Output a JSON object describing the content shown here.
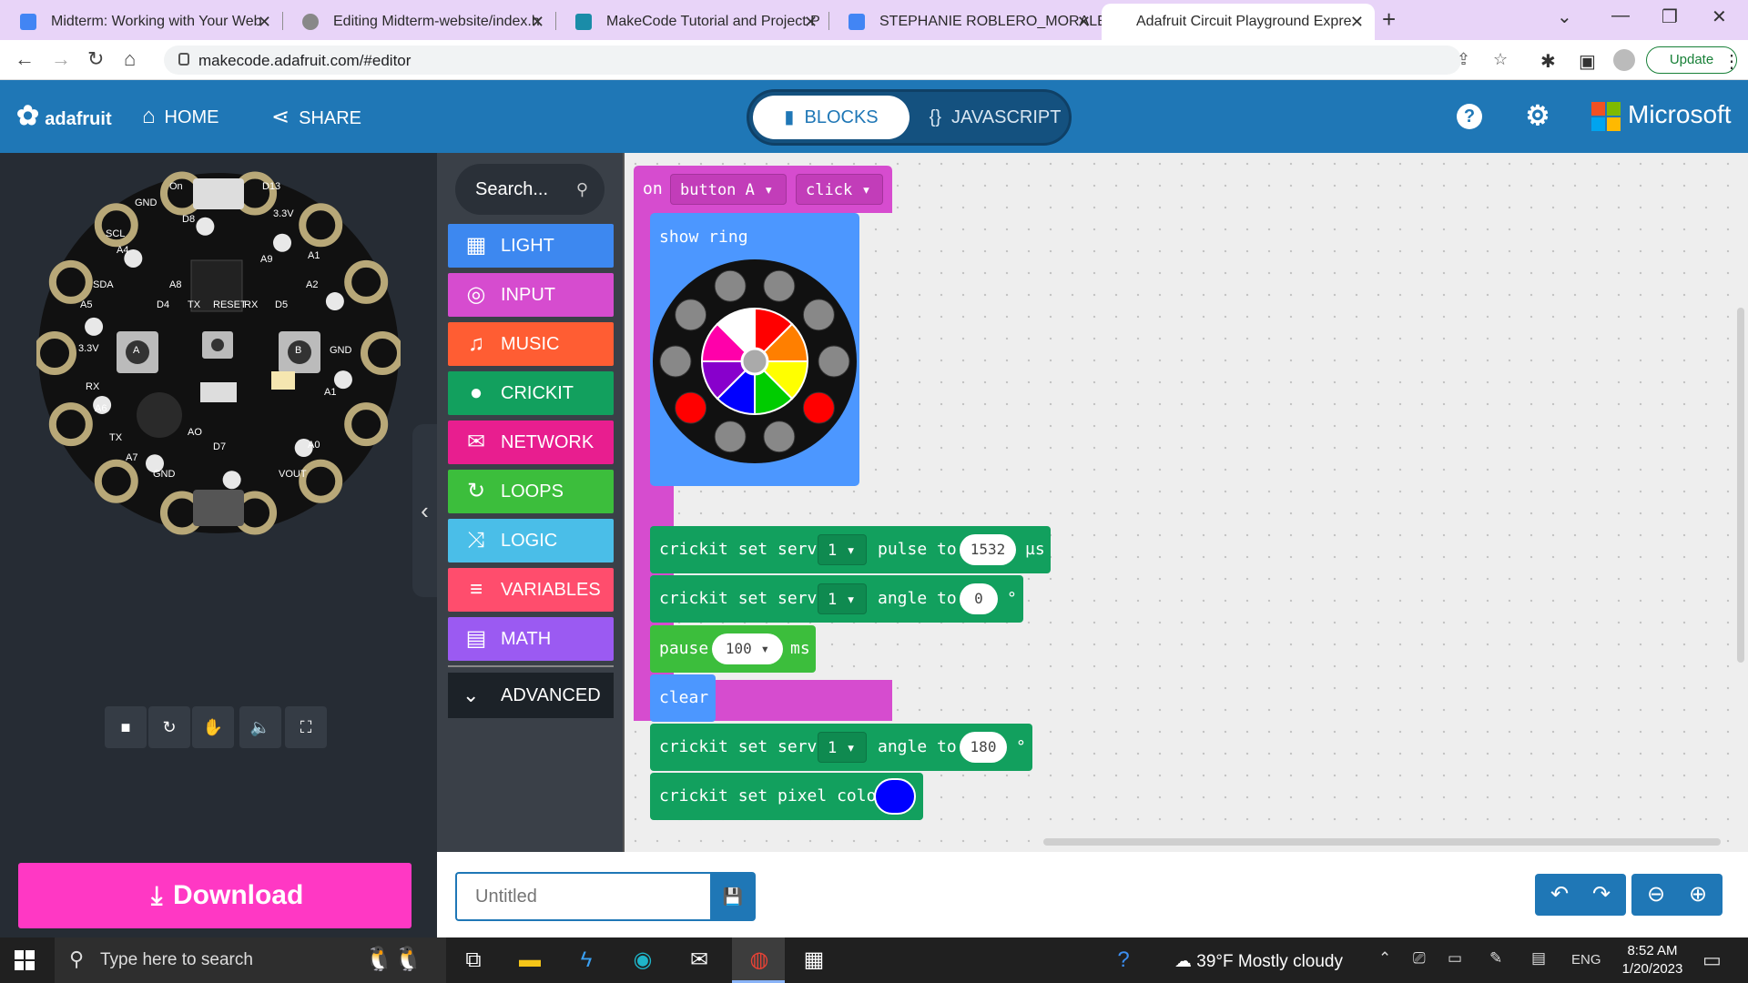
{
  "browser": {
    "tabs": [
      {
        "title": "Midterm: Working with Your Web",
        "color": "#4285f4"
      },
      {
        "title": "Editing Midterm-website/index.h",
        "color": "#888888"
      },
      {
        "title": "MakeCode Tutorial and Project P",
        "color": "#1a8ca8"
      },
      {
        "title": "STEPHANIE ROBLERO_MORALES",
        "color": "#4285f4"
      },
      {
        "title": "Adafruit Circuit Playground Expre",
        "color": ""
      }
    ],
    "url": "makecode.adafruit.com/#editor",
    "update_label": "Update"
  },
  "header": {
    "logo_text": "adafruit",
    "home_label": "HOME",
    "share_label": "SHARE",
    "blocks_label": "BLOCKS",
    "javascript_label": "JAVASCRIPT",
    "help_icon": "?",
    "brand": "Microsoft"
  },
  "simulator": {
    "pin_labels": [
      "On",
      "D13",
      "GND",
      "D8",
      "3.3V",
      "SCL",
      "A4",
      "A1",
      "A9",
      "A8",
      "SDA",
      "A5",
      "A2",
      "D4",
      "TX",
      "RESET",
      "RX",
      "D5",
      "3.3V",
      "GND",
      "RX",
      "A6",
      "A1",
      "TX",
      "A7",
      "AO",
      "D7",
      "A0",
      "GND",
      "VOUT",
      "A",
      "B"
    ],
    "led_colors": [
      "#ff0000",
      "#ff0000"
    ]
  },
  "toolbox": {
    "search_placeholder": "Search...",
    "categories": [
      {
        "label": "LIGHT",
        "color": "#3d88f0",
        "icon": "grid-icon"
      },
      {
        "label": "INPUT",
        "color": "#d64ccf",
        "icon": "target-icon"
      },
      {
        "label": "MUSIC",
        "color": "#ff5d33",
        "icon": "headphones-icon"
      },
      {
        "label": "CRICKIT",
        "color": "#12a05e",
        "icon": "circle-icon"
      },
      {
        "label": "NETWORK",
        "color": "#e81e8f",
        "icon": "chat-icon"
      },
      {
        "label": "LOOPS",
        "color": "#3cbe3c",
        "icon": "refresh-icon"
      },
      {
        "label": "LOGIC",
        "color": "#4abee8",
        "icon": "shuffle-icon"
      },
      {
        "label": "VARIABLES",
        "color": "#ff4d6d",
        "icon": "lines-icon"
      },
      {
        "label": "MATH",
        "color": "#9b5af2",
        "icon": "calculator-icon"
      }
    ],
    "advanced_label": "ADVANCED"
  },
  "blocks": {
    "event": {
      "on": "on",
      "button": "button A",
      "action": "click",
      "color": "#d64ccf"
    },
    "show_ring": {
      "label": "show ring",
      "color": "#4c97ff"
    },
    "ring_colors": [
      "#ff0000",
      "#ff7f00",
      "#ffff00",
      "#00cc00",
      "#0000ff",
      "#8800cc",
      "#ff00aa",
      "#ffffff"
    ],
    "ring_outer_on": [
      "#ff0000",
      "#ff0000"
    ],
    "servo_pulse": {
      "text": "crickit set servo",
      "servo": "1",
      "mid": "pulse to",
      "value": "1532",
      "unit": "µs"
    },
    "servo_angle1": {
      "text": "crickit set servo",
      "servo": "1",
      "mid": "angle to",
      "value": "0",
      "unit": "°"
    },
    "pause": {
      "text": "pause",
      "value": "100",
      "unit": "ms"
    },
    "clear": {
      "text": "clear"
    },
    "servo_angle2": {
      "text": "crickit set servo",
      "servo": "1",
      "mid": "angle to",
      "value": "180",
      "unit": "°"
    },
    "pixel_color": {
      "text": "crickit set pixel color",
      "value_color": "#0000ff"
    },
    "crickit_color": "#12a05e",
    "loops_color": "#3cbe3c"
  },
  "bottom": {
    "download_label": "Download",
    "project_placeholder": "Untitled"
  },
  "taskbar": {
    "search_placeholder": "Type here to search",
    "weather": "39°F  Mostly cloudy",
    "lang": "ENG",
    "time": "8:52 AM",
    "date": "1/20/2023"
  }
}
